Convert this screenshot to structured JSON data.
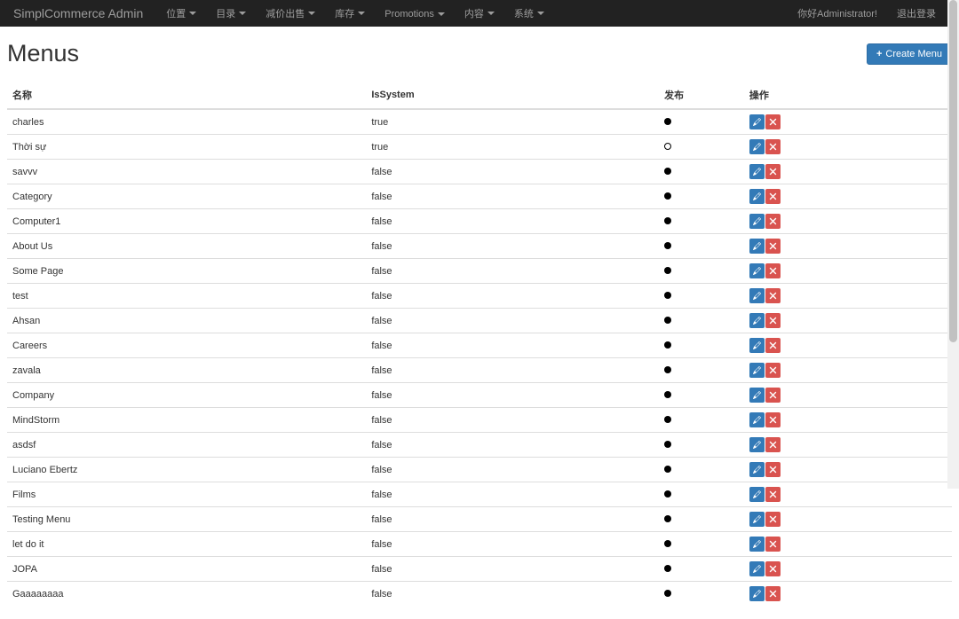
{
  "navbar": {
    "brand": "SimplCommerce Admin",
    "items": [
      {
        "label": "位置",
        "dropdown": true
      },
      {
        "label": "目录",
        "dropdown": true
      },
      {
        "label": "减价出售",
        "dropdown": true
      },
      {
        "label": "库存",
        "dropdown": true
      },
      {
        "label": "Promotions",
        "dropdown": true
      },
      {
        "label": "内容",
        "dropdown": true
      },
      {
        "label": "系统",
        "dropdown": true
      }
    ],
    "right": {
      "greeting": "你好Administrator!",
      "logout": "退出登录"
    }
  },
  "page": {
    "title": "Menus",
    "create_label": "Create Menu"
  },
  "table": {
    "headers": {
      "name": "名称",
      "is_system": "IsSystem",
      "published": "发布",
      "actions": "操作"
    },
    "rows": [
      {
        "name": "charles",
        "isSystem": "true",
        "published": true
      },
      {
        "name": "Thời sự",
        "isSystem": "true",
        "published": false
      },
      {
        "name": "savvv",
        "isSystem": "false",
        "published": true
      },
      {
        "name": "Category",
        "isSystem": "false",
        "published": true
      },
      {
        "name": "Computer1",
        "isSystem": "false",
        "published": true
      },
      {
        "name": "About Us",
        "isSystem": "false",
        "published": true
      },
      {
        "name": "Some Page",
        "isSystem": "false",
        "published": true
      },
      {
        "name": "test",
        "isSystem": "false",
        "published": true
      },
      {
        "name": "Ahsan",
        "isSystem": "false",
        "published": true
      },
      {
        "name": "Careers",
        "isSystem": "false",
        "published": true
      },
      {
        "name": "zavala",
        "isSystem": "false",
        "published": true
      },
      {
        "name": "Company",
        "isSystem": "false",
        "published": true
      },
      {
        "name": "MindStorm",
        "isSystem": "false",
        "published": true
      },
      {
        "name": "asdsf",
        "isSystem": "false",
        "published": true
      },
      {
        "name": "Luciano Ebertz",
        "isSystem": "false",
        "published": true
      },
      {
        "name": "Films",
        "isSystem": "false",
        "published": true
      },
      {
        "name": "Testing Menu",
        "isSystem": "false",
        "published": true
      },
      {
        "name": "let do it",
        "isSystem": "false",
        "published": true
      },
      {
        "name": "JOPA",
        "isSystem": "false",
        "published": true
      },
      {
        "name": "Gaaaaaaaa",
        "isSystem": "false",
        "published": true
      }
    ]
  }
}
